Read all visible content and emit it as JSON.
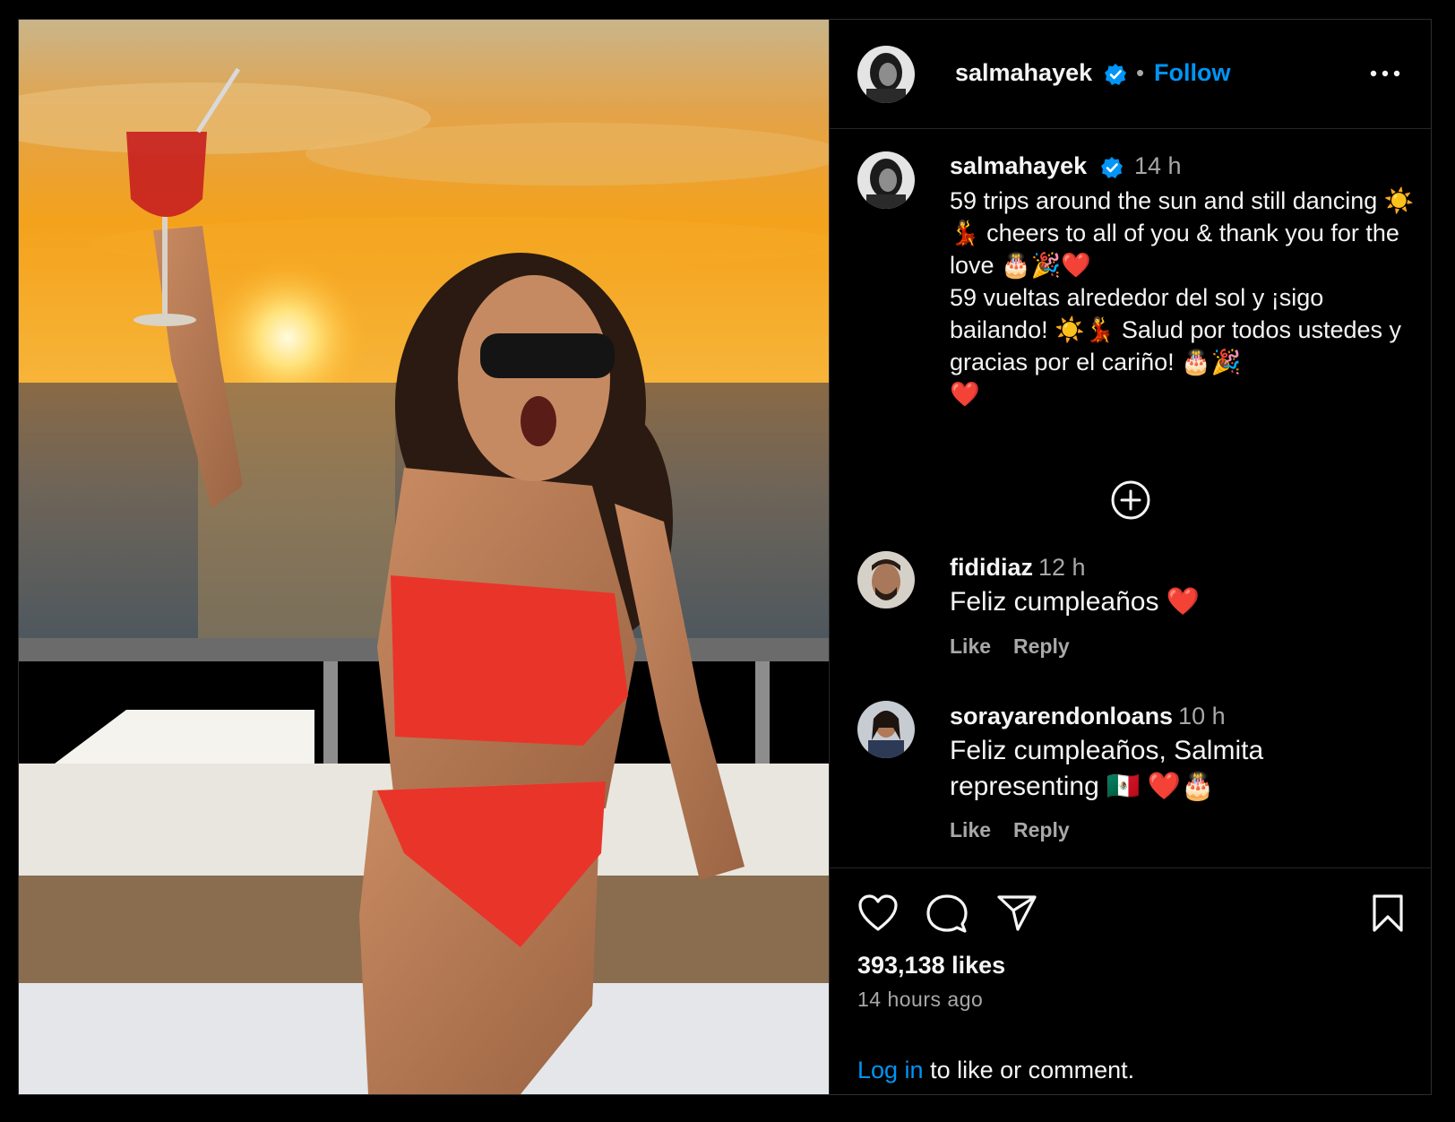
{
  "post": {
    "username": "salmahayek",
    "follow_label": "Follow",
    "separator": "•"
  },
  "caption": {
    "username": "salmahayek",
    "time": "14 h",
    "text": "59 trips around the sun and still dancing ☀️💃 cheers to all of you & thank you for the love 🎂🎉❤️\n59 vueltas alrededor del sol y ¡sigo bailando! ☀️💃 Salud por todos ustedes y gracias por el cariño! 🎂🎉\n❤️"
  },
  "comments": [
    {
      "username": "fididiaz",
      "time": "12 h",
      "text": "Feliz cumpleaños ❤️",
      "like_label": "Like",
      "reply_label": "Reply"
    },
    {
      "username": "sorayarendonloans",
      "time": "10 h",
      "text": "Feliz cumpleaños, Salmita representing 🇲🇽 ❤️🎂",
      "like_label": "Like",
      "reply_label": "Reply"
    }
  ],
  "engagement": {
    "likes": "393,138 likes",
    "posted": "14 hours ago"
  },
  "login": {
    "link": "Log in",
    "rest": " to like or comment."
  },
  "icons": {
    "like": "heart-icon",
    "comment": "comment-icon",
    "share": "share-icon",
    "save": "bookmark-icon",
    "more": "more-icon",
    "load_more": "plus-circle-icon",
    "verified": "verified-badge-icon"
  },
  "colors": {
    "background": "#000000",
    "link": "#0095f6",
    "muted": "#a8a8a8",
    "verified": "#0095f6"
  }
}
